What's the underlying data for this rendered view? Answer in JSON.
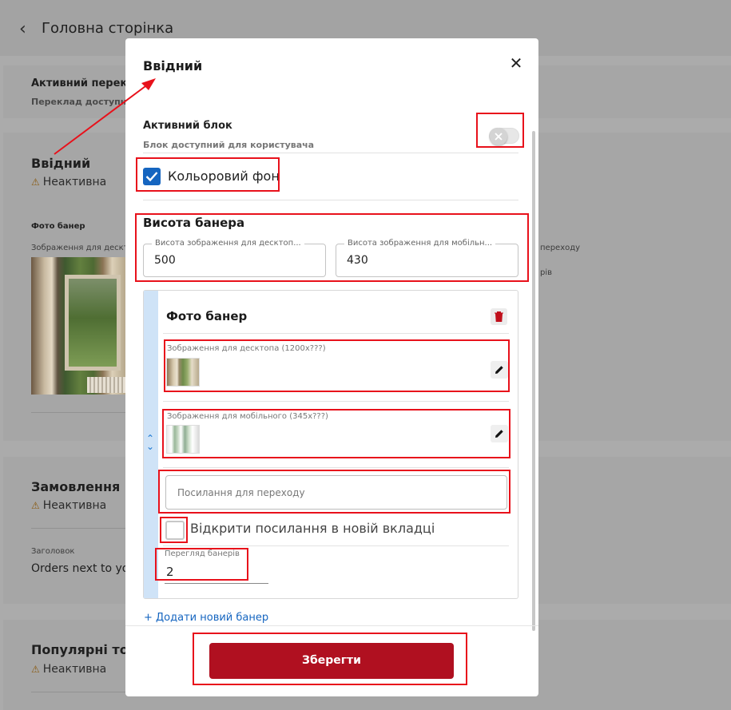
{
  "background": {
    "header": {
      "back_icon": "chevron-left-icon",
      "title": "Головна сторінка"
    },
    "translation_card": {
      "title": "Активний перекл",
      "subtitle": "Переклад доступн"
    },
    "intro_card": {
      "title": "Ввідний",
      "status": "Неактивна",
      "photo_banner": "Фото банер",
      "desktop_image_label": "Зображення для десктоп",
      "right_label": "переходу",
      "right_label_2": "рів"
    },
    "orders_card": {
      "title": "Замовлення по",
      "status": "Неактивна",
      "heading_label": "Заголовок",
      "heading_value": "Orders next to you"
    },
    "popular_card": {
      "title": "Популярні това",
      "status": "Неактивна"
    }
  },
  "modal": {
    "title": "Ввідний",
    "close_icon": "close-icon",
    "active_block": {
      "label": "Активний блок",
      "description": "Блок доступний для користувача",
      "toggle_on": false
    },
    "colored_background": {
      "label": "Кольоровий фон",
      "checked": true
    },
    "banner_height": {
      "title": "Висота банера",
      "desktop": {
        "legend": "Висота зображення для десктоп...",
        "value": "500"
      },
      "mobile": {
        "legend": "Висота зображення для мобільн...",
        "value": "430"
      }
    },
    "photo_banner": {
      "title": "Фото банер",
      "delete_icon": "trash-icon",
      "expand_icon": "chevron-up-down-icon",
      "desktop_image": {
        "label": "Зображення для десктопа (1200x???)",
        "edit_icon": "pencil-icon"
      },
      "mobile_image": {
        "label": "Зображення для мобільного (345x???)",
        "edit_icon": "pencil-icon"
      },
      "link_placeholder": "Посилання для переходу",
      "open_in_new_tab": {
        "label": "Відкрити посилання в новій вкладці",
        "checked": false
      },
      "preview": {
        "legend": "Перегляд банерів",
        "value": "2"
      }
    },
    "add_banner": "+ Додати новий банер",
    "save": "Зберегти"
  },
  "colors": {
    "accent_red": "#b01020",
    "checkbox_blue": "#1565c0",
    "annotation_red": "#e8111b"
  }
}
